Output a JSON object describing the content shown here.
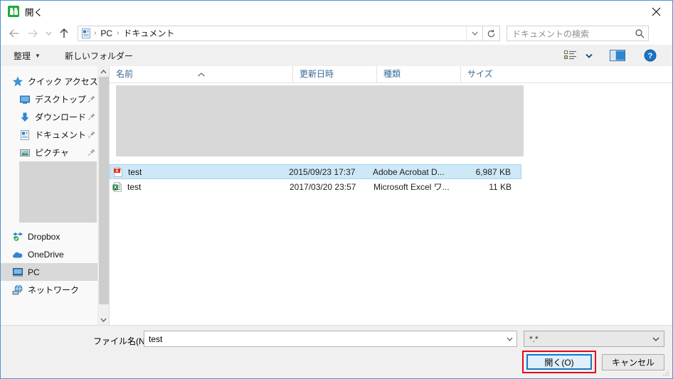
{
  "window": {
    "title": "開く",
    "app_icon": "people-green-icon",
    "close_label": "✕",
    "accent_border": "#4d94d1"
  },
  "nav": {
    "back_icon": "arrow-left-icon",
    "forward_icon": "arrow-right-icon",
    "recent_icon": "chevron-down-icon",
    "up_icon": "arrow-up-icon",
    "refresh_icon": "refresh-icon",
    "address": {
      "folder_icon": "documents-folder-icon",
      "crumbs": [
        "PC",
        "ドキュメント"
      ],
      "separator": "›",
      "dropdown_icon": "chevron-down-icon"
    },
    "search": {
      "placeholder": "ドキュメントの検索",
      "icon": "search-icon"
    }
  },
  "toolbar": {
    "organize_label": "整理",
    "organize_caret": "▼",
    "new_folder_label": "新しいフォルダー",
    "view_icon": "list-view-icon",
    "view_caret_icon": "chevron-down-icon",
    "preview_pane_icon": "preview-pane-icon",
    "help_icon": "help-icon"
  },
  "sidebar": {
    "items": [
      {
        "label": "クイック アクセス",
        "icon": "star-icon",
        "pinned": false,
        "indent": false,
        "selected": false
      },
      {
        "label": "デスクトップ",
        "icon": "desktop-icon",
        "pinned": true,
        "indent": true,
        "selected": false
      },
      {
        "label": "ダウンロード",
        "icon": "download-icon",
        "pinned": true,
        "indent": true,
        "selected": false
      },
      {
        "label": "ドキュメント",
        "icon": "documents-icon",
        "pinned": true,
        "indent": true,
        "selected": false
      },
      {
        "label": "ピクチャ",
        "icon": "pictures-icon",
        "pinned": true,
        "indent": true,
        "selected": false
      },
      {
        "label": "Dropbox",
        "icon": "dropbox-icon",
        "pinned": false,
        "indent": false,
        "selected": false
      },
      {
        "label": "OneDrive",
        "icon": "onedrive-icon",
        "pinned": false,
        "indent": false,
        "selected": false
      },
      {
        "label": "PC",
        "icon": "pc-icon",
        "pinned": false,
        "indent": false,
        "selected": true
      },
      {
        "label": "ネットワーク",
        "icon": "network-icon",
        "pinned": false,
        "indent": false,
        "selected": false
      }
    ],
    "scroll_up_icon": "chevron-up-icon",
    "scroll_down_icon": "chevron-down-icon"
  },
  "filelist": {
    "columns": [
      {
        "label": "名前",
        "sorted": true,
        "sort_caret": "▲"
      },
      {
        "label": "更新日時",
        "sorted": false
      },
      {
        "label": "種類",
        "sorted": false
      },
      {
        "label": "サイズ",
        "sorted": false
      }
    ],
    "rows": [
      {
        "name": "test",
        "icon": "pdf-file-icon",
        "date": "2015/09/23 17:37",
        "type": "Adobe Acrobat D...",
        "size": "6,987 KB",
        "selected": true
      },
      {
        "name": "test",
        "icon": "excel-file-icon",
        "date": "2017/03/20 23:57",
        "type": "Microsoft Excel ワ...",
        "size": "11 KB",
        "selected": false
      }
    ]
  },
  "footer": {
    "filename_label": "ファイル名(N):",
    "filename_value": "test",
    "filename_caret_icon": "chevron-down-icon",
    "filter_value": "*.*",
    "filter_caret_icon": "chevron-down-icon",
    "open_label": "開く(O)",
    "cancel_label": "キャンセル",
    "highlight_color": "#e8051b",
    "focus_color": "#1277c8"
  }
}
